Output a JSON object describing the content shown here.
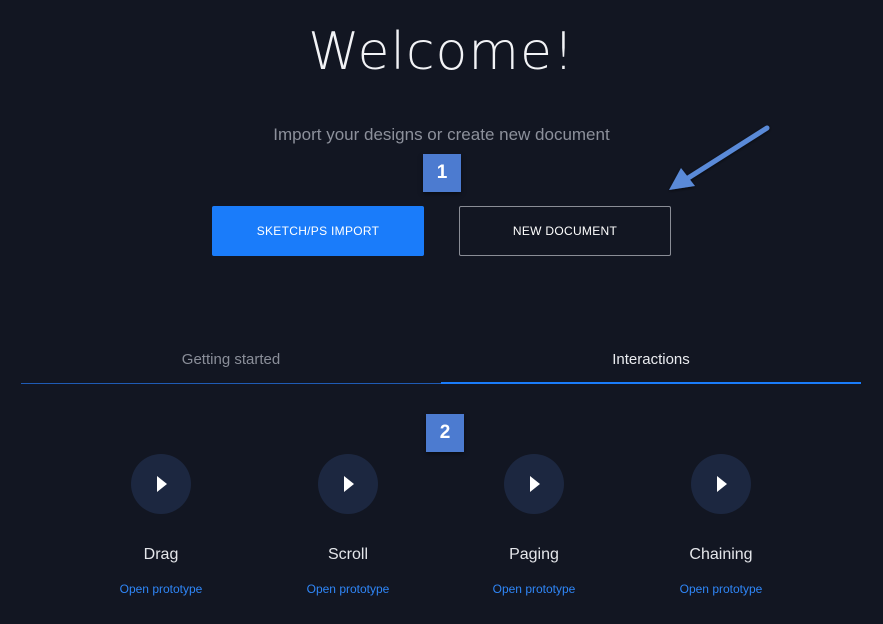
{
  "header": {
    "title": "Welcome!",
    "subtitle": "Import your designs or create new document"
  },
  "markers": {
    "first": "1",
    "second": "2"
  },
  "actions": {
    "import_label": "SKETCH/PS IMPORT",
    "new_document_label": "NEW DOCUMENT"
  },
  "tabs": [
    {
      "label": "Getting started",
      "active": false
    },
    {
      "label": "Interactions",
      "active": true
    }
  ],
  "prototypes": [
    {
      "title": "Drag",
      "link": "Open prototype"
    },
    {
      "title": "Scroll",
      "link": "Open prototype"
    },
    {
      "title": "Paging",
      "link": "Open prototype"
    },
    {
      "title": "Chaining",
      "link": "Open prototype"
    }
  ],
  "icons": {
    "play": "play-icon",
    "annotation_arrow": "arrow-icon"
  },
  "colors": {
    "background": "#121622",
    "accent": "#1a7cfa",
    "marker": "#4c7bd0",
    "link": "#2f86f7"
  }
}
